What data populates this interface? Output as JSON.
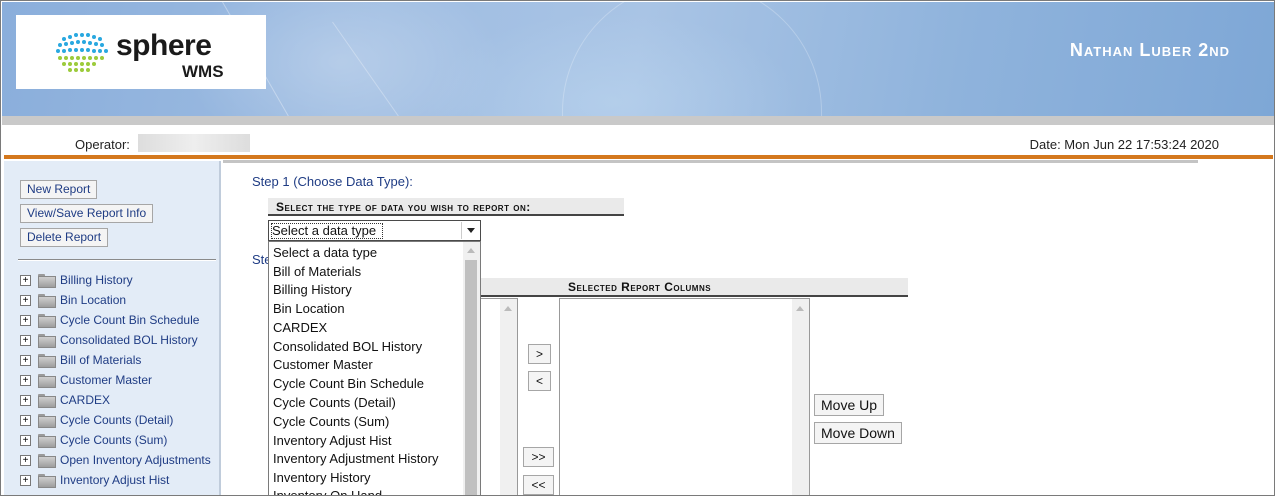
{
  "header": {
    "logo_text": "sphere",
    "logo_sub": "WMS",
    "company_name": "Nathan Luber 2nd"
  },
  "operator_bar": {
    "operator_label": "Operator:",
    "date_text": "Date: Mon Jun 22 17:53:24 2020"
  },
  "sidebar": {
    "buttons": {
      "new_report": "New Report",
      "view_save": "View/Save Report Info",
      "delete_report": "Delete Report"
    },
    "tree": [
      "Billing History",
      "Bin Location",
      "Cycle Count Bin Schedule",
      "Consolidated BOL History",
      "Bill of Materials",
      "Customer Master",
      "CARDEX",
      "Cycle Counts (Detail)",
      "Cycle Counts (Sum)",
      "Open Inventory Adjustments",
      "Inventory Adjust Hist"
    ]
  },
  "main": {
    "step1_label": "Step 1 (Choose Data Type):",
    "step2_label": "Ste",
    "select_header": "Select the type of data you wish to report on:",
    "select_value": "Select a data type",
    "dropdown_options": [
      "Select a data type",
      "Bill of Materials",
      "Billing History",
      "Bin Location",
      "CARDEX",
      "Consolidated BOL History",
      "Customer Master",
      "Cycle Count Bin Schedule",
      "Cycle Counts (Detail)",
      "Cycle Counts (Sum)",
      "Inventory Adjust Hist",
      "Inventory Adjustment History",
      "Inventory History",
      "Inventory On Hand"
    ],
    "selected_columns_header": "Selected Report Columns",
    "move_buttons": {
      "add": ">",
      "remove": "<",
      "add_all": ">>",
      "remove_all": "<<"
    },
    "move_up": "Move Up",
    "move_down": "Move Down"
  }
}
